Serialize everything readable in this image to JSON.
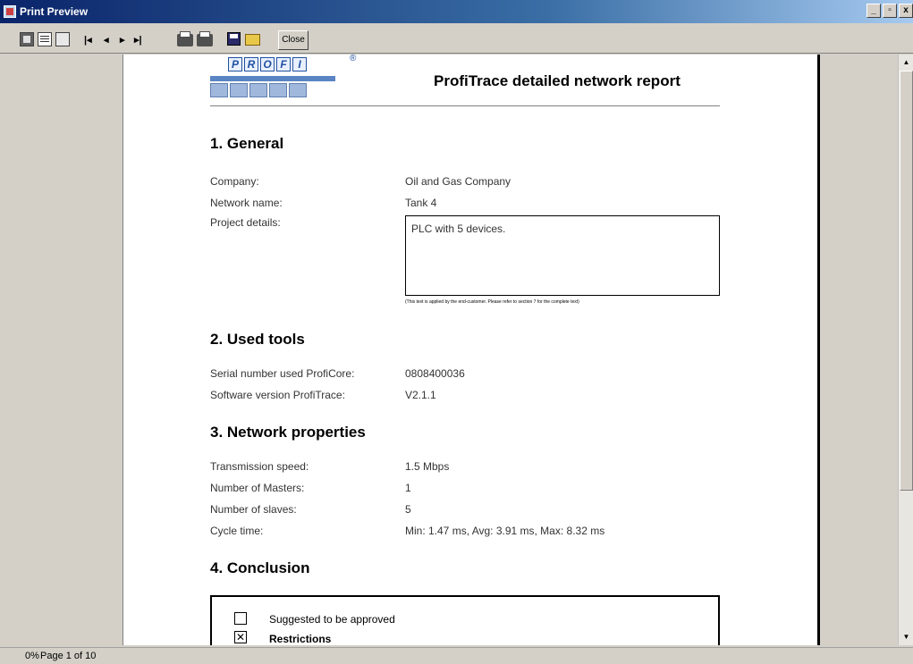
{
  "window": {
    "title": "Print Preview",
    "controls": {
      "minimize": "_",
      "maximize": "▫",
      "close": "x"
    }
  },
  "toolbar": {
    "close_label": "Close",
    "nav": {
      "first": "|◂",
      "prev": "◂",
      "next": "▸",
      "last": "▸|"
    }
  },
  "status": {
    "zoom": "0%",
    "page": "Page 1 of 10"
  },
  "report": {
    "title": "ProfiTrace detailed network report",
    "logo": {
      "letters": [
        "P",
        "R",
        "O",
        "F",
        "I"
      ],
      "registered": "®"
    },
    "general": {
      "heading": "1. General",
      "company_label": "Company:",
      "company_value": "Oil and Gas Company",
      "network_label": "Network name:",
      "network_value": "Tank 4",
      "project_label": "Project details:",
      "project_value": "PLC with 5 devices.",
      "note": "(This text is applied by the end-customer. Please refer to section 7 for the complete text)"
    },
    "tools": {
      "heading": "2. Used tools",
      "serial_label": "Serial number used ProfiCore:",
      "serial_value": "0808400036",
      "software_label": "Software version ProfiTrace:",
      "software_value": "V2.1.1"
    },
    "network": {
      "heading": "3. Network properties",
      "speed_label": "Transmission speed:",
      "speed_value": "1.5 Mbps",
      "masters_label": "Number of Masters:",
      "masters_value": "1",
      "slaves_label": "Number of slaves:",
      "slaves_value": "5",
      "cycle_label": "Cycle time:",
      "cycle_value": "Min: 1.47 ms, Avg: 3.91 ms, Max: 8.32 ms"
    },
    "conclusion": {
      "heading": "4. Conclusion",
      "option1_label": "Suggested to be approved",
      "option1_checked": false,
      "option2_label": "Restrictions",
      "option2_checked": true,
      "check_mark": "✕"
    }
  }
}
